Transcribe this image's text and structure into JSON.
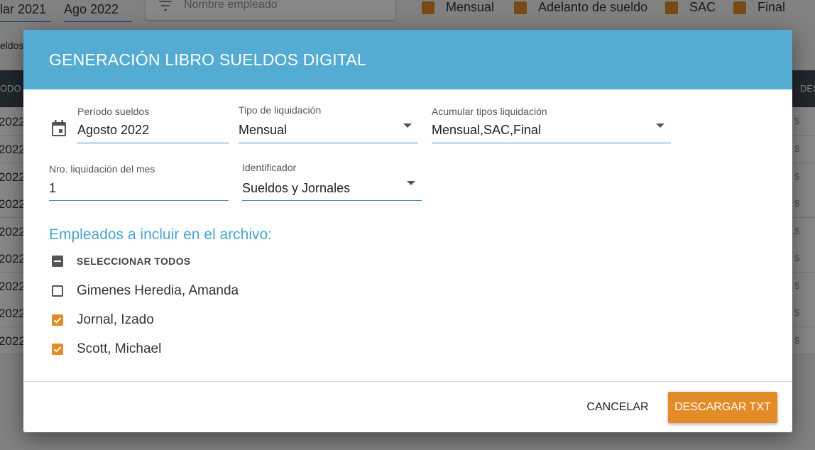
{
  "background": {
    "date_from": "lar 2021",
    "date_to": "Ago 2022",
    "search_placeholder": "Nombre empleado",
    "filter_checks": [
      {
        "label": "Mensual",
        "checked": true
      },
      {
        "label": "Adelanto de sueldo",
        "checked": true
      },
      {
        "label": "SAC",
        "checked": true
      },
      {
        "label": "Final",
        "checked": true
      }
    ],
    "tab_label": "eldos",
    "table_header_left": "ODO",
    "table_header_right": "DES",
    "row_years": [
      "2022",
      "2022",
      "2022",
      "2022",
      "2022",
      "2022",
      "2022",
      "2022",
      "2022"
    ],
    "row_currency": "$"
  },
  "dialog": {
    "title": "GENERACIÓN LIBRO SUELDOS DIGITAL",
    "periodo": {
      "label": "Período sueldos",
      "value": "Agosto 2022"
    },
    "tipo": {
      "label": "Tipo de liquidación",
      "value": "Mensual"
    },
    "acumular": {
      "label": "Acumular tipos liquidación",
      "value": "Mensual,SAC,Final"
    },
    "nro": {
      "label": "Nro. liquidación del mes",
      "value": "1"
    },
    "identificador": {
      "label": "Identificador",
      "value": "Sueldos y Jornales"
    },
    "section_title": "Empleados a incluir en el archivo:",
    "select_all_label": "SELECCIONAR TODOS",
    "select_all_state": "indeterminate",
    "employees": [
      {
        "name": "Gimenes Heredia, Amanda",
        "checked": false
      },
      {
        "name": "Jornal, Izado",
        "checked": true
      },
      {
        "name": "Scott, Michael",
        "checked": true
      }
    ],
    "cancel_label": "CANCELAR",
    "download_label": "DESCARGAR TXT"
  },
  "colors": {
    "header_blue": "#55acd3",
    "accent_orange": "#e38b26",
    "section_blue": "#4aa6cf",
    "underline_blue": "#3e93bd"
  }
}
